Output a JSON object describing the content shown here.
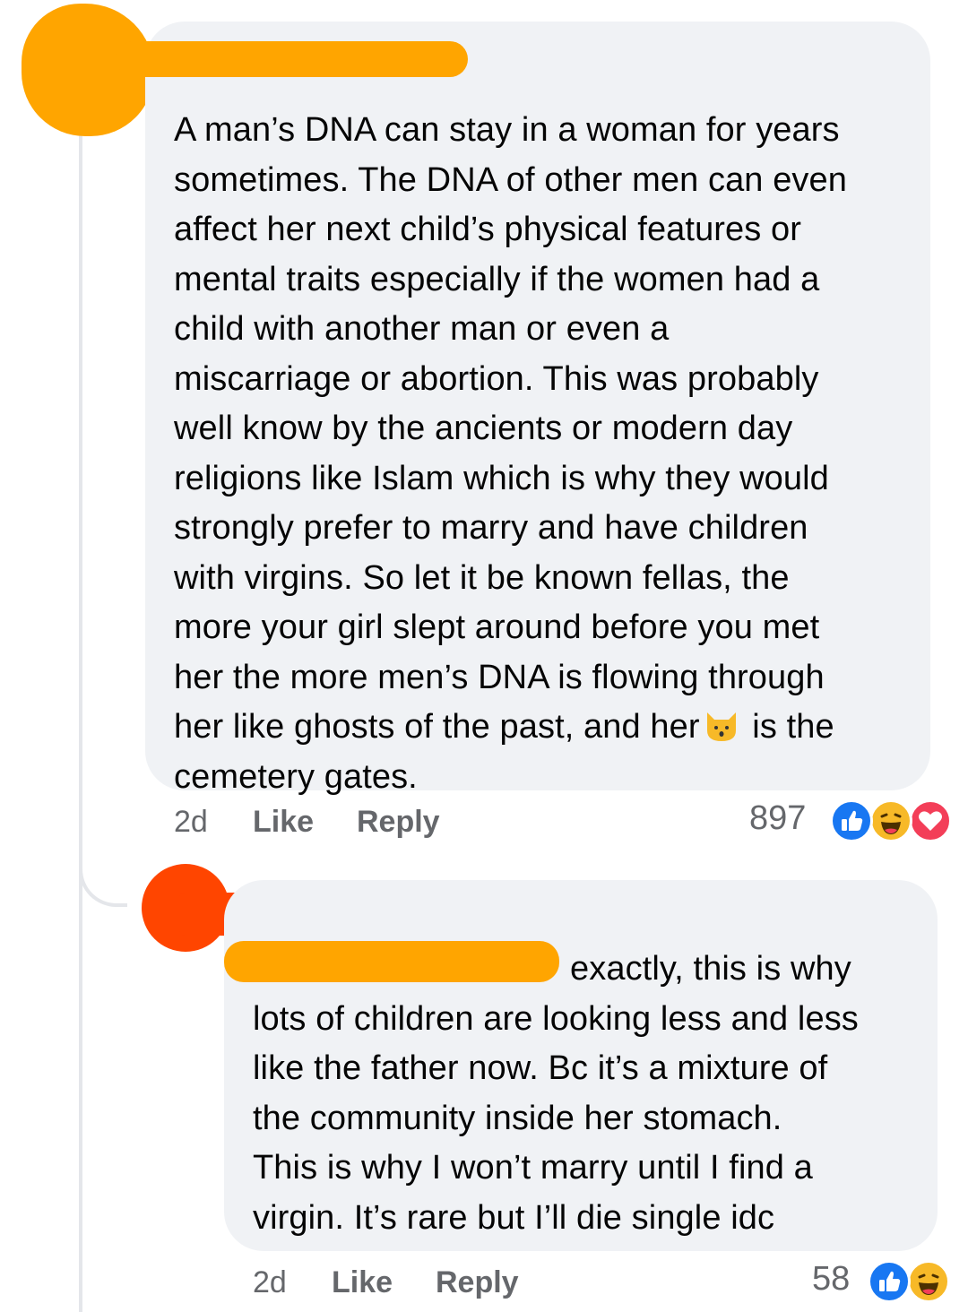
{
  "comments": [
    {
      "text_parts": [
        "A man’s DNA can stay in a woman for years\nsometimes. The DNA of other men can even\naffect her next child’s physical features or\nmental traits especially if the women had a\nchild with another man or even a\nmiscarriage or abortion. This was probably\nwell know by the ancients or modern day\nreligions like Islam which is why they would\nstrongly prefer to marry and have children\nwith virgins. So let it be known fellas, the\nmore your girl slept around before you met\nher the more men’s DNA is flowing through\nher like ghosts of the past, and her",
        " is the\ncemetery gates."
      ],
      "inline_emoji": "cat-face-icon",
      "time": "2d",
      "like_label": "Like",
      "reply_label": "Reply",
      "reaction_count": "897",
      "reactions": [
        "like-icon",
        "haha-icon",
        "love-icon"
      ]
    },
    {
      "text": "exactly, this is why\nlots of children are looking less and less\nlike the father now. Bc it’s a mixture of\nthe community inside her stomach.\nThis is why I won’t marry until I find a\nvirgin. It’s rare but I’ll die single idc",
      "time": "2d",
      "like_label": "Like",
      "reply_label": "Reply",
      "reaction_count": "58",
      "reactions": [
        "like-icon",
        "haha-icon"
      ]
    }
  ],
  "colors": {
    "bubble": "#f0f2f5",
    "text": "#050505",
    "meta": "#65676b",
    "like_blue": "#1877f2",
    "love_red": "#f33e58",
    "haha_yellow": "#f7b928",
    "redaction_orange": "#ffa500",
    "redaction_red_orange": "#ff4500"
  }
}
